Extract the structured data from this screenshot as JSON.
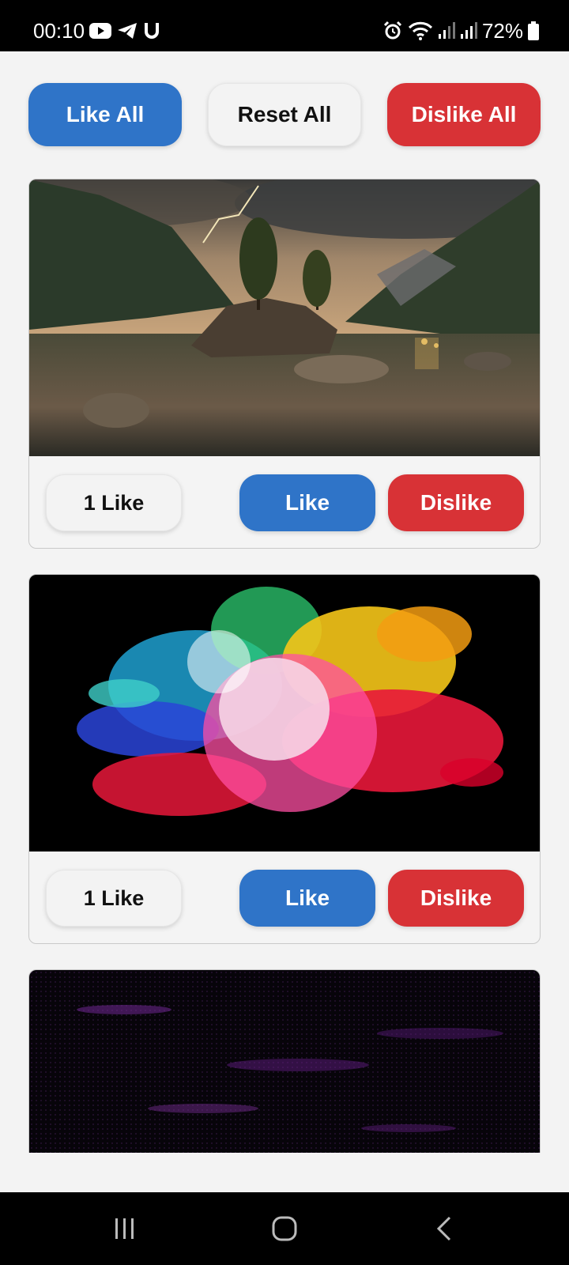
{
  "status_bar": {
    "time": "00:10",
    "left_icons": [
      "youtube-icon",
      "telegram-icon",
      "u-app-icon"
    ],
    "right_icons": [
      "alarm-icon",
      "wifi-icon",
      "signal-icon",
      "signal-icon",
      "battery-icon"
    ],
    "battery": "72%"
  },
  "top_actions": {
    "like_all": "Like All",
    "reset_all": "Reset All",
    "dislike_all": "Dislike All"
  },
  "cards": [
    {
      "image": "lake-landscape-lightning-image",
      "count_label": "1 Like",
      "like_label": "Like",
      "dislike_label": "Dislike"
    },
    {
      "image": "color-powder-explosion-image",
      "count_label": "1 Like",
      "like_label": "Like",
      "dislike_label": "Dislike"
    },
    {
      "image": "dark-purple-particles-image"
    }
  ],
  "nav_bar": {
    "items": [
      "recent-apps-icon",
      "home-icon",
      "back-icon"
    ]
  },
  "colors": {
    "like_blue": "#2f74c8",
    "dislike_red": "#d83236",
    "background": "#f3f3f3"
  }
}
